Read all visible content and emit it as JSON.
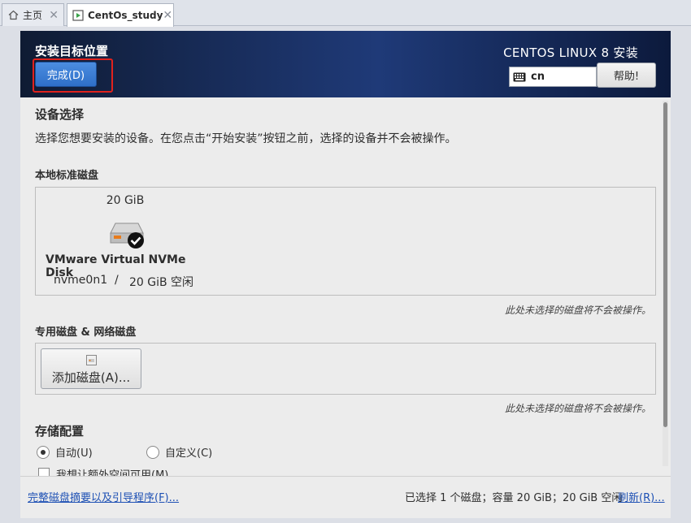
{
  "tabs": [
    {
      "label": "主页",
      "icon": "home-icon"
    },
    {
      "label": "CentOs_study",
      "icon": "vm-icon"
    }
  ],
  "header": {
    "title": "安装目标位置",
    "done_label": "完成(D)",
    "product": "CENTOS LINUX 8 安装",
    "keyboard_layout": "cn",
    "help_label": "帮助!",
    "highlight_color": "#e0221d"
  },
  "device_selection": {
    "heading": "设备选择",
    "description": "选择您想要安装的设备。在您点击“开始安装”按钮之前，选择的设备并不会被操作。",
    "local_heading": "本地标准磁盘",
    "disk": {
      "size": "20 GiB",
      "name": "VMware Virtual NVMe Disk",
      "device": "nvme0n1",
      "separator": "/",
      "free": "20 GiB 空闲",
      "selected": true
    },
    "local_note": "此处未选择的磁盘将不会被操作。",
    "special_heading": "专用磁盘 & 网络磁盘",
    "add_disk_label": "添加磁盘(A)...",
    "special_note": "此处未选择的磁盘将不会被操作。"
  },
  "storage": {
    "heading": "存储配置",
    "auto_label": "自动(U)",
    "custom_label": "自定义(C)",
    "selected": "auto",
    "extra_space_label": "我想让额外空间可用(M)"
  },
  "footer": {
    "summary_link": "完整磁盘摘要以及引导程序(F)...",
    "status": "已选择 1 个磁盘；容量 20 GiB；20 GiB 空闲",
    "refresh_link": "刷新(R)..."
  }
}
